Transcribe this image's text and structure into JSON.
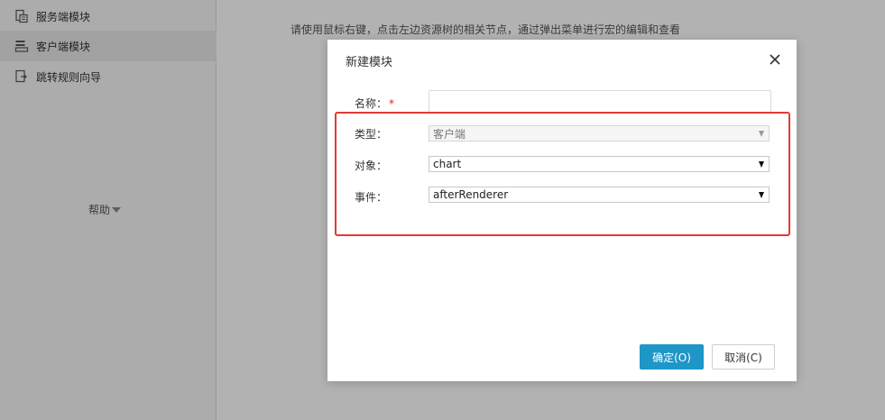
{
  "sidebar": {
    "items": [
      {
        "label": "服务端模块",
        "icon": "server-module-icon",
        "active": false
      },
      {
        "label": "客户端模块",
        "icon": "client-module-icon",
        "active": true
      },
      {
        "label": "跳转规则向导",
        "icon": "jump-rule-wizard-icon",
        "active": false
      }
    ],
    "help_label": "帮助"
  },
  "main": {
    "hint_text": "请使用鼠标右键，点击左边资源树的相关节点，通过弹出菜单进行宏的编辑和查看"
  },
  "dialog": {
    "title": "新建模块",
    "fields": {
      "name": {
        "label": "名称：",
        "required_mark": "*",
        "value": "",
        "placeholder": ""
      },
      "type": {
        "label": "类型：",
        "value": "客户端",
        "disabled": true
      },
      "object": {
        "label": "对象：",
        "value": "chart"
      },
      "event": {
        "label": "事件：",
        "value": "afterRenderer"
      }
    },
    "buttons": {
      "ok": "确定(O)",
      "cancel": "取消(C)"
    }
  },
  "colors": {
    "primary": "#1e96c8",
    "highlight": "#e53935",
    "required": "#e02020"
  }
}
